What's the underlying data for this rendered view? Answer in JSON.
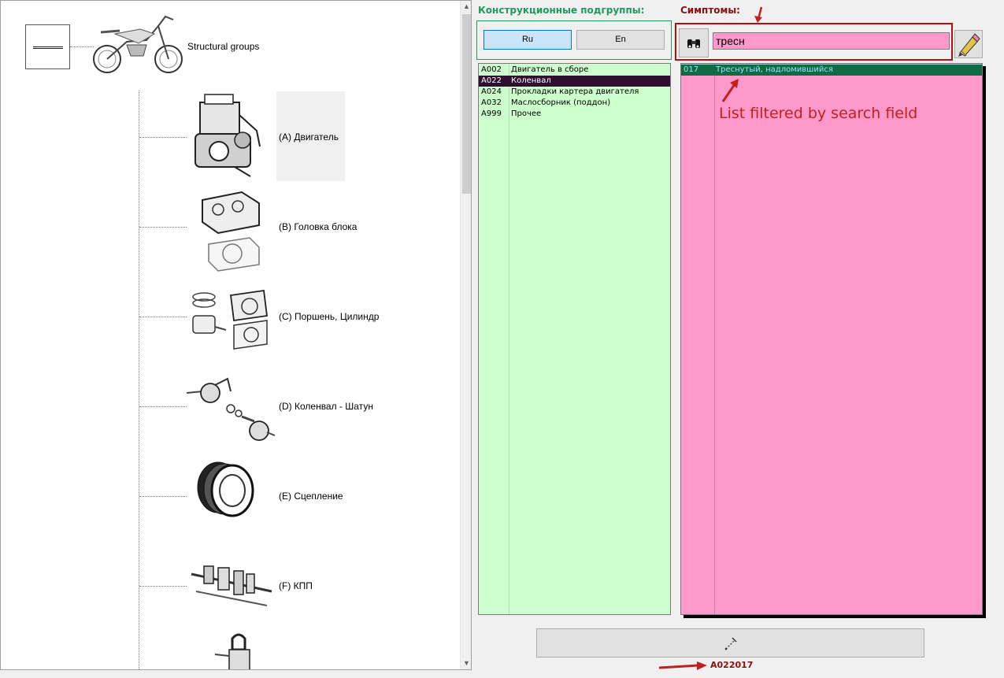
{
  "tree": {
    "root_label": "Structural groups",
    "nodes": [
      {
        "label": "(A) Двигатель",
        "icon": "engine-icon"
      },
      {
        "label": "(B) Головка блока",
        "icon": "cylinder-head-icon"
      },
      {
        "label": "(C) Поршень, Цилиндр",
        "icon": "piston-cylinder-icon"
      },
      {
        "label": "(D) Коленвал - Шатун",
        "icon": "crankshaft-icon"
      },
      {
        "label": "(E) Сцепление",
        "icon": "clutch-icon"
      },
      {
        "label": "(F) КПП",
        "icon": "gearbox-icon"
      },
      {
        "label": "",
        "icon": "ignition-coil-icon"
      }
    ]
  },
  "subgroups": {
    "title": "Конструкционные подгруппы:",
    "lang_buttons": {
      "ru": "Ru",
      "en": "En"
    },
    "active_lang": "ru",
    "rows": [
      {
        "code": "A002",
        "name": "Двигатель в сборе",
        "selected": false
      },
      {
        "code": "A022",
        "name": "Коленвал",
        "selected": true
      },
      {
        "code": "A024",
        "name": "Прокладки картера двигателя",
        "selected": false
      },
      {
        "code": "A032",
        "name": "Маслосборник (поддон)",
        "selected": false
      },
      {
        "code": "A999",
        "name": "Прочее",
        "selected": false
      }
    ]
  },
  "symptoms": {
    "title": "Симптомы:",
    "search_value": "тресн",
    "rows": [
      {
        "code": "017",
        "name": "Треснутый, надломившийся",
        "selected": true
      }
    ]
  },
  "annotation": "List filtered by search field",
  "footer": {
    "code": "A022017"
  },
  "icons": {
    "search_button": "binoculars-icon",
    "clear_button": "eraser-pencil-icon",
    "action_button": "wand-icon"
  },
  "colors": {
    "subgroup_list_bg": "#ccffcc",
    "symptom_list_bg": "#ff99cc",
    "subgroup_title": "#1f9a5b",
    "symptom_title": "#8b0f0f",
    "annotation": "#c21f1f"
  }
}
